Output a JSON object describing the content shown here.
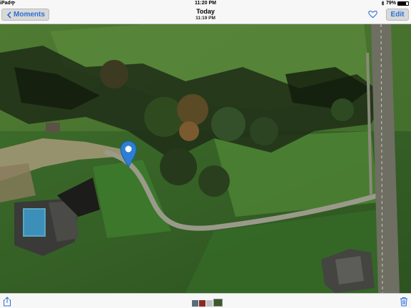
{
  "status_bar": {
    "carrier": "iPad",
    "time": "11:20 PM",
    "battery_percent": "79%",
    "battery_level": 0.79
  },
  "nav": {
    "back_label": "Moments",
    "title": "Today",
    "subtitle": "11:19 PM",
    "edit_label": "Edit"
  },
  "photo": {
    "type": "satellite-image",
    "pin_color": "#2d7fd3"
  },
  "toolbar": {
    "thumbnail_count": 4,
    "icons": [
      "share-icon",
      "trash-icon"
    ]
  },
  "colors": {
    "accent": "#2a6fd6",
    "bar_background": "#f7f7f7"
  }
}
